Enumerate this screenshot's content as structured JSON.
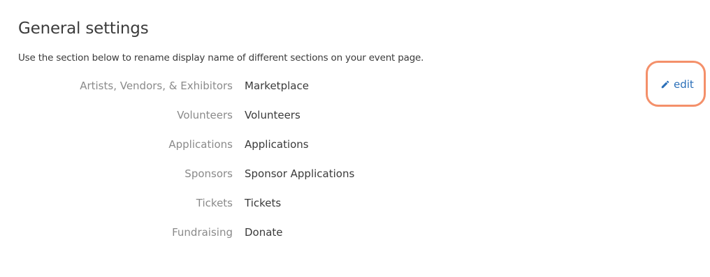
{
  "header": {
    "title": "General settings",
    "description": "Use the section below to rename display name of different sections on your event page."
  },
  "sections": [
    {
      "label": "Artists, Vendors, & Exhibitors",
      "value": "Marketplace"
    },
    {
      "label": "Volunteers",
      "value": "Volunteers"
    },
    {
      "label": "Applications",
      "value": "Applications"
    },
    {
      "label": "Sponsors",
      "value": "Sponsor Applications"
    },
    {
      "label": "Tickets",
      "value": "Tickets"
    },
    {
      "label": "Fundraising",
      "value": "Donate"
    }
  ],
  "edit": {
    "label": "edit",
    "icon": "pencil-icon",
    "color": "#2a6fb8",
    "highlight_color": "#f4906a"
  }
}
